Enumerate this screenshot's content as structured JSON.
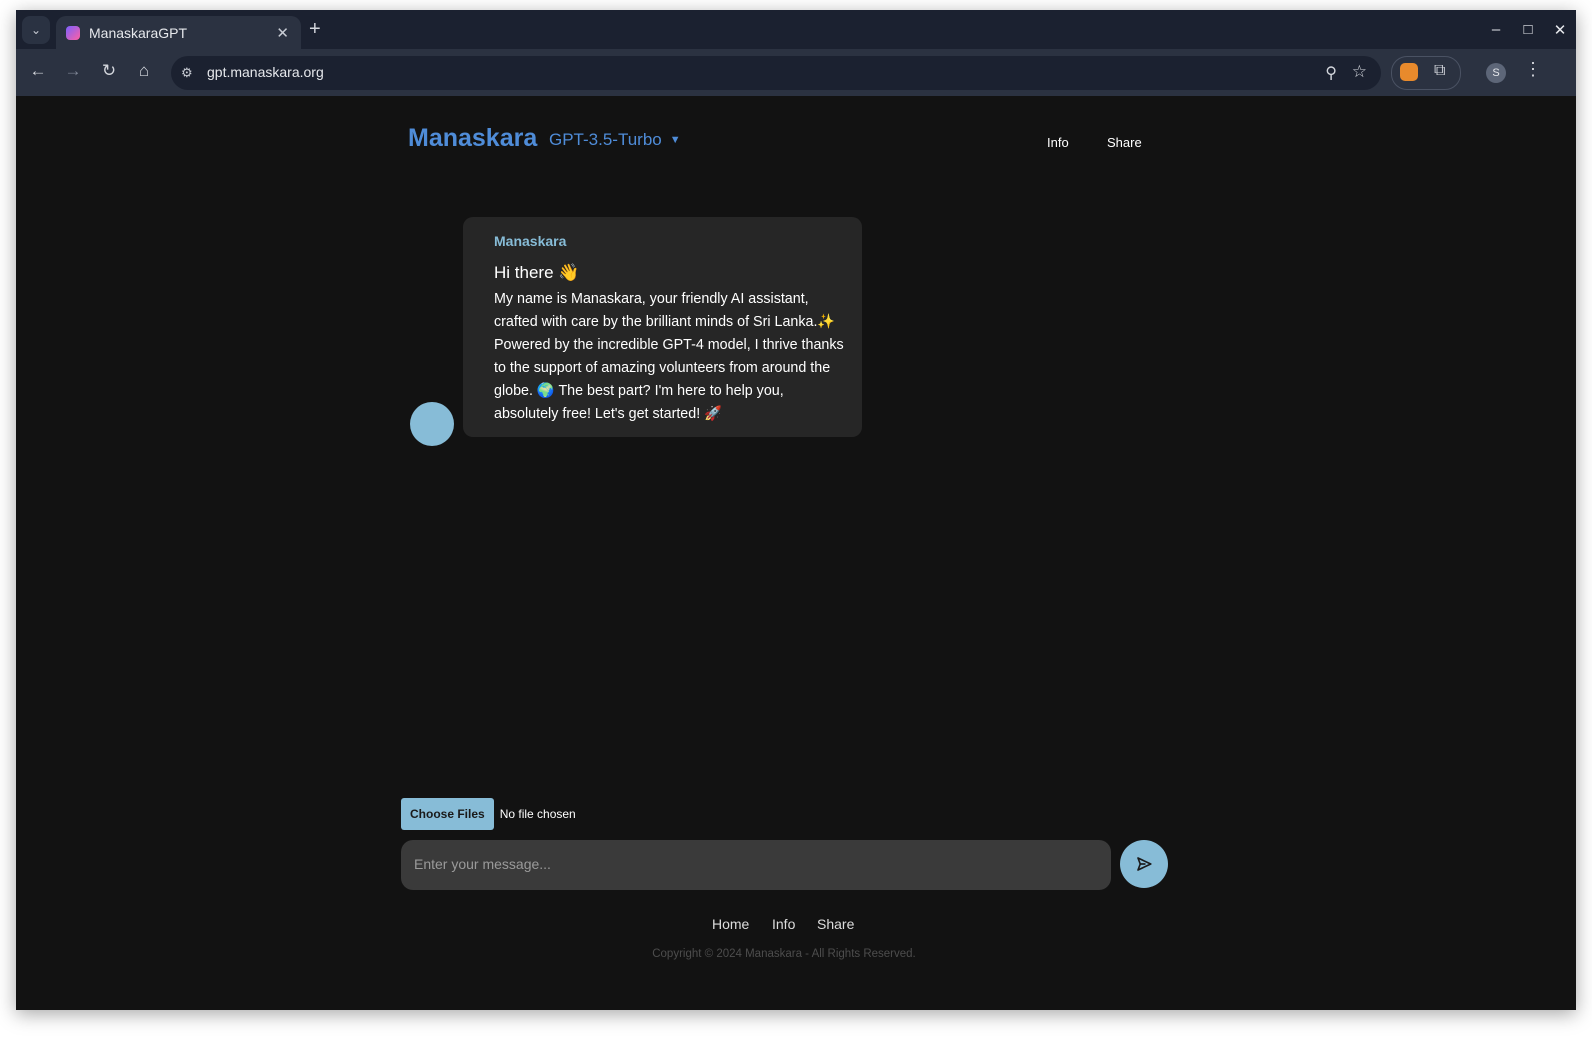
{
  "browser": {
    "tab_title": "ManaskaraGPT",
    "url": "gpt.manaskara.org",
    "profile_initial": "S",
    "icons": [
      "tab-search-icon",
      "close-icon",
      "new-tab-icon",
      "minimize-icon",
      "maximize-icon",
      "window-close-icon",
      "back-icon",
      "forward-icon",
      "reload-icon",
      "home-icon",
      "site-info-icon",
      "zoom-icon",
      "bookmark-star-icon",
      "extension-fox-icon",
      "extensions-puzzle-icon",
      "kebab-menu-icon"
    ]
  },
  "header": {
    "brand": "Manaskara",
    "model": "GPT-3.5-Turbo",
    "nav": [
      "Info",
      "Share"
    ]
  },
  "chat": {
    "sender": "Manaskara",
    "greeting": "Hi there 👋",
    "message": "My name is Manaskara, your friendly AI assistant, crafted with care by the brilliant minds of Sri Lanka.✨ Powered by the incredible GPT-4 model, I thrive thanks to the support of amazing volunteers from around the globe. 🌍 The best part? I'm here to help you, absolutely free! Let's get started! 🚀"
  },
  "composer": {
    "choose_files_label": "Choose Files",
    "no_file_label": "No file chosen",
    "placeholder": "Enter your message..."
  },
  "footer": {
    "links": [
      "Home",
      "Info",
      "Share"
    ],
    "copyright": "Copyright © 2024 Manaskara - All Rights Reserved."
  },
  "colors": {
    "accent": "#4f8cd8",
    "avatar": "#87bcd7",
    "background": "#121212",
    "bubble": "#262626"
  }
}
